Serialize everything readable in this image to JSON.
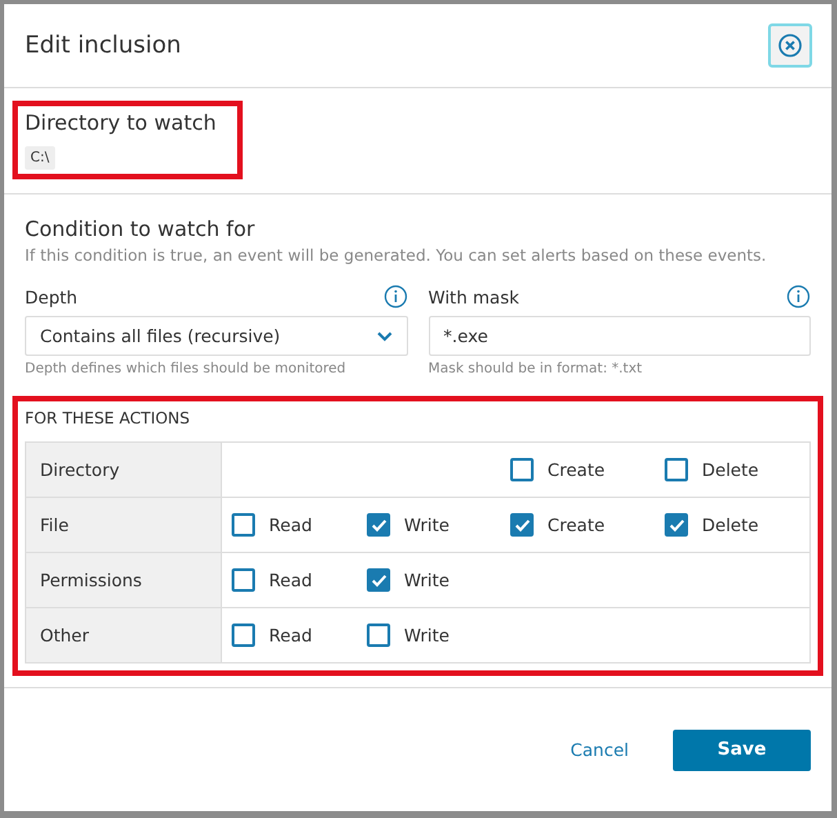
{
  "dialog": {
    "title": "Edit inclusion"
  },
  "directory": {
    "heading": "Directory to watch",
    "path": "C:\\",
    "highlighted": true
  },
  "condition": {
    "heading": "Condition to watch for",
    "description": "If this condition is true, an event will be generated. You can set alerts based on these events.",
    "depth": {
      "label": "Depth",
      "value": "Contains all files (recursive)",
      "hint": "Depth defines which files should be monitored"
    },
    "mask": {
      "label": "With mask",
      "value": "*.exe",
      "hint": "Mask should be in format: *.txt"
    }
  },
  "actions": {
    "heading": "FOR THESE ACTIONS",
    "highlighted": true,
    "rows": [
      {
        "name": "Directory",
        "options": [
          {
            "kind": "create",
            "label": "Create",
            "checked": false
          },
          {
            "kind": "delete",
            "label": "Delete",
            "checked": false
          }
        ]
      },
      {
        "name": "File",
        "options": [
          {
            "kind": "read",
            "label": "Read",
            "checked": false
          },
          {
            "kind": "write",
            "label": "Write",
            "checked": true
          },
          {
            "kind": "create",
            "label": "Create",
            "checked": true
          },
          {
            "kind": "delete",
            "label": "Delete",
            "checked": true
          }
        ]
      },
      {
        "name": "Permissions",
        "options": [
          {
            "kind": "read",
            "label": "Read",
            "checked": false
          },
          {
            "kind": "write",
            "label": "Write",
            "checked": true
          }
        ]
      },
      {
        "name": "Other",
        "options": [
          {
            "kind": "read",
            "label": "Read",
            "checked": false
          },
          {
            "kind": "write",
            "label": "Write",
            "checked": false
          }
        ]
      }
    ]
  },
  "buttons": {
    "cancel": "Cancel",
    "save": "Save"
  }
}
